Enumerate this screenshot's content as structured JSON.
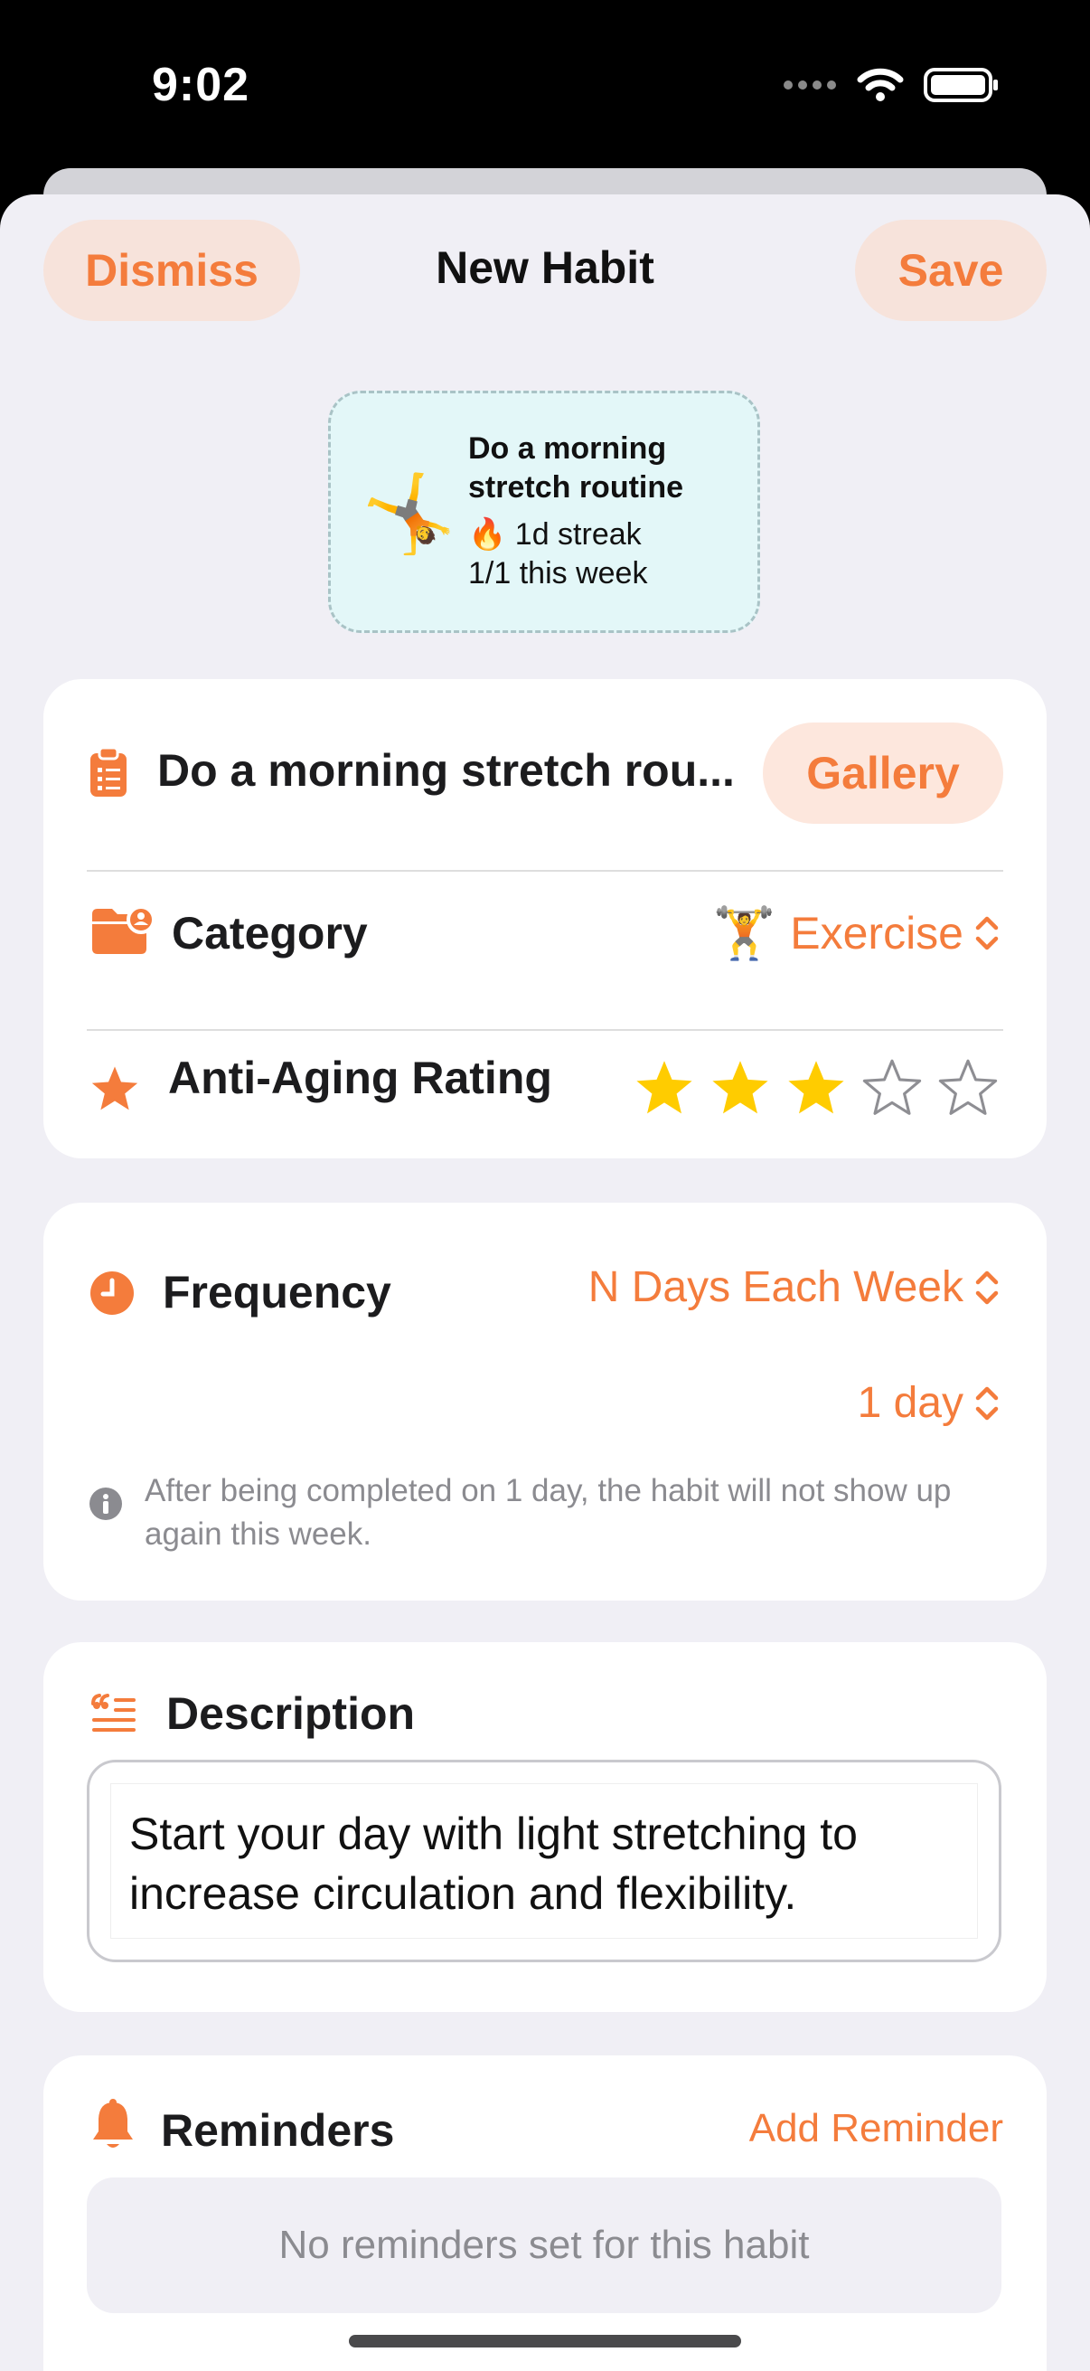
{
  "status": {
    "time": "9:02"
  },
  "header": {
    "dismiss": "Dismiss",
    "title": "New Habit",
    "save": "Save"
  },
  "preview": {
    "emoji": "🤸",
    "title": "Do a morning stretch routine",
    "streak": "🔥 1d streak",
    "week": "1/1 this week"
  },
  "basics": {
    "name_value": "Do a morning stretch rou...",
    "gallery": "Gallery",
    "category_label": "Category",
    "category_emoji": "🏋️",
    "category_value": "Exercise",
    "rating_label": "Anti-Aging Rating",
    "rating": 3,
    "rating_max": 5
  },
  "frequency": {
    "label": "Frequency",
    "mode": "N Days Each Week",
    "days": "1 day",
    "note": "After being completed on 1 day, the habit will not show up again this week."
  },
  "description": {
    "label": "Description",
    "text": "Start your day with light stretching to increase circulation and flexibility."
  },
  "reminders": {
    "label": "Reminders",
    "add": "Add Reminder",
    "empty": "No reminders set for this habit"
  },
  "colors": {
    "accent": "#f47c3c",
    "star": "#ffcc00",
    "preview_bg": "#e3f7f8"
  }
}
